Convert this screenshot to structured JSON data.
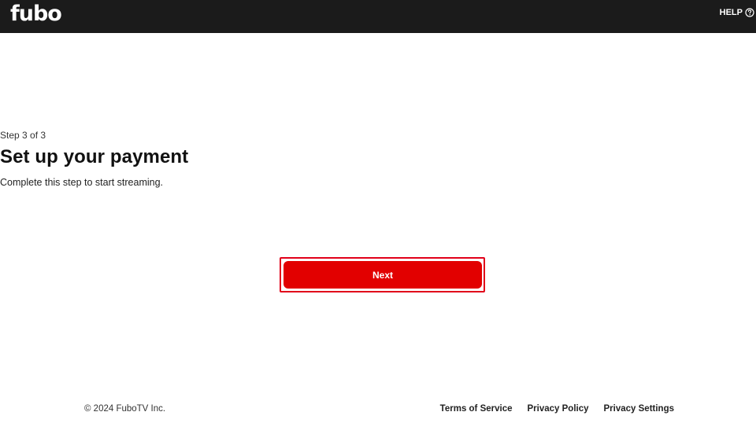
{
  "header": {
    "logo_text": "fubo",
    "help_label": "HELP",
    "help_icon": "question-circle-icon",
    "background_color": "#1b1b1b"
  },
  "main": {
    "step_text": "Step 3 of 3",
    "title": "Set up your payment",
    "subtitle": "Complete this step to start streaming.",
    "next_label": "Next",
    "accent_color": "#e20000"
  },
  "footer": {
    "copyright": "© 2024 FuboTV Inc.",
    "links": [
      "Terms of Service",
      "Privacy Policy",
      "Privacy Settings"
    ]
  }
}
